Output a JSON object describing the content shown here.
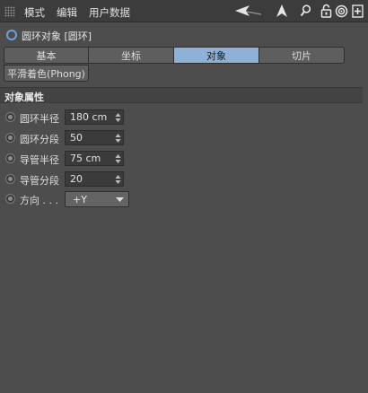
{
  "menu": {
    "items": [
      "模式",
      "编辑",
      "用户数据"
    ],
    "icons": [
      "back-arrow-icon",
      "up-arrow-icon",
      "search-icon",
      "lock-icon",
      "target-icon",
      "add-panel-icon"
    ]
  },
  "object": {
    "icon": "torus-icon",
    "title": "圆环对象 [圆环]"
  },
  "tabs": {
    "items": [
      "基本",
      "坐标",
      "对象",
      "切片"
    ],
    "active": "对象",
    "subtab": "平滑着色(Phong)"
  },
  "section": {
    "title": "对象属性"
  },
  "properties": [
    {
      "label": "圆环半径",
      "value": "180 cm"
    },
    {
      "label": "圆环分段",
      "value": "50"
    },
    {
      "label": "导管半径",
      "value": "75 cm"
    },
    {
      "label": "导管分段",
      "value": "20"
    }
  ],
  "orientation": {
    "label": "方向 . . .",
    "value": "+Y"
  },
  "colors": {
    "background": "#4d4d4d",
    "active_tab": "#8fb1d6",
    "torus_icon": "#6aa3d8"
  }
}
